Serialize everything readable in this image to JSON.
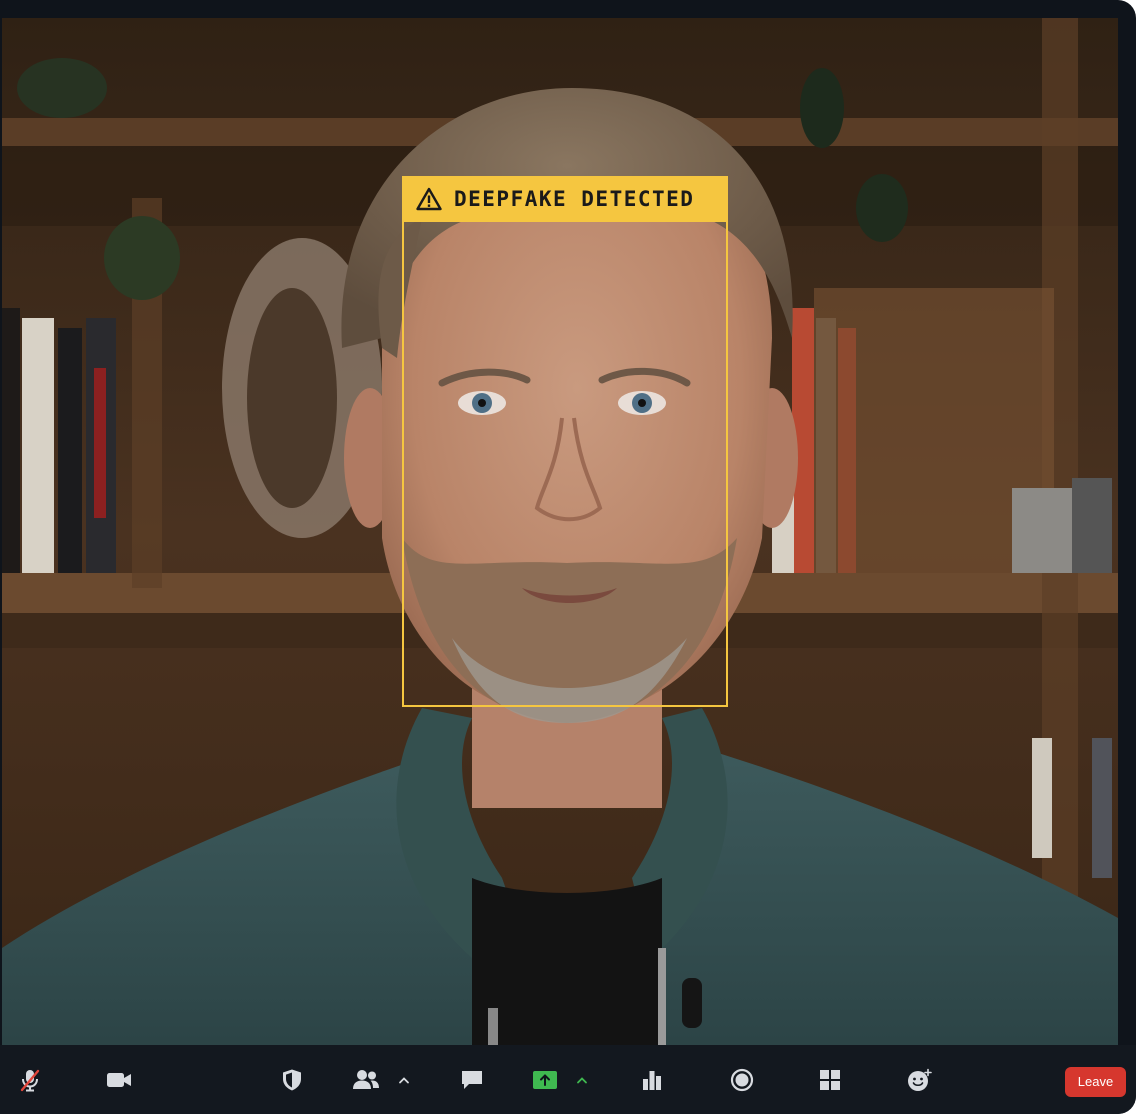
{
  "overlay": {
    "label": "DEEPFAKE DETECTED",
    "icon": "warning-triangle-icon",
    "color": "#f5c640"
  },
  "toolbar": {
    "items": [
      {
        "icon": "microphone-muted-icon"
      },
      {
        "icon": "video-camera-icon"
      },
      {
        "icon": "shield-icon"
      },
      {
        "icon": "participants-icon"
      },
      {
        "icon": "chevron-up-icon"
      },
      {
        "icon": "chat-icon"
      },
      {
        "icon": "share-screen-icon"
      },
      {
        "icon": "chevron-up-icon"
      },
      {
        "icon": "bar-chart-icon"
      },
      {
        "icon": "record-icon"
      },
      {
        "icon": "apps-grid-icon"
      },
      {
        "icon": "reactions-icon"
      }
    ],
    "leave_label": "Leave",
    "leave_color": "#d6372e",
    "share_color": "#3fb950"
  }
}
